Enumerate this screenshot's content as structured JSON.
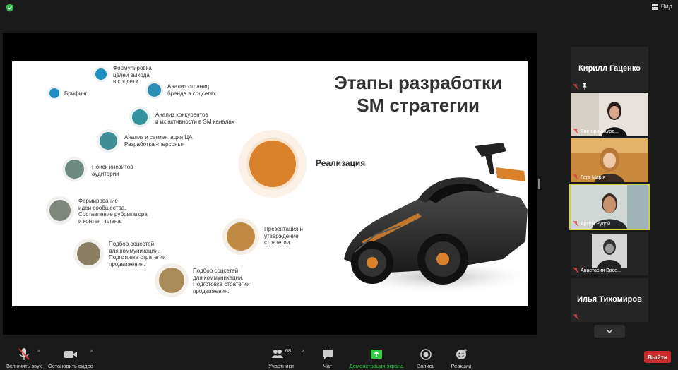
{
  "topbar": {
    "view_label": "Вид"
  },
  "slide": {
    "title_line1": "Этапы разработки",
    "title_line2": "SM стратегии",
    "implementation_label": "Реализация",
    "stages": [
      {
        "label": "Брифинг"
      },
      {
        "label": "Формулировка\nцелей выхода\nв соцсети"
      },
      {
        "label": "Анализ страниц\nбренда в соцсетях"
      },
      {
        "label": "Анализ конкурентов\nи их активности в SM каналах"
      },
      {
        "label": "Анализ и сегментация ЦА\nРазработка «персоны»"
      },
      {
        "label": "Поиск инсайтов\nаудитории"
      },
      {
        "label": "Формирование\nидеи сообщества.\nСоставление рубрикатора\nи контент плана."
      },
      {
        "label": "Подбор соцсетей\nдля коммуникации.\nПодготовка стратегии\nпродвижения."
      },
      {
        "label": "Подбор соцсетей\nдля коммуникации.\nПодготовка стратегии\nпродвижения."
      },
      {
        "label": "Презентация и\nутверждение\nстратегии"
      }
    ],
    "colors": {
      "blue": "#1f8fc2",
      "teal": "#3e8e95",
      "grey_green": "#6d8a80",
      "grey": "#7f877c",
      "olive": "#8a7f62",
      "tan": "#a98b5a",
      "light_brown": "#c08a45",
      "orange": "#d9822b"
    }
  },
  "participants": [
    {
      "name": "Кирилл Гаценко",
      "type": "name-only"
    },
    {
      "name": "Виктория  Хурд...",
      "type": "video"
    },
    {
      "name": "Гета Марія",
      "type": "video"
    },
    {
      "name": "Артём Рудой",
      "type": "video",
      "active": true
    },
    {
      "name": "Анастасия Васе...",
      "type": "video"
    },
    {
      "name": "Илья Тихомиров",
      "type": "name-only"
    }
  ],
  "toolbar": {
    "unmute_label": "Включить звук",
    "stop_video_label": "Остановить видео",
    "participants_label": "Участники",
    "participants_count": "68",
    "chat_label": "Чат",
    "share_label": "Демонстрация экрана",
    "record_label": "Запись",
    "reactions_label": "Реакции",
    "leave_label": "Выйти",
    "share_color": "#2ecc40",
    "leave_color": "#c72b2b"
  }
}
